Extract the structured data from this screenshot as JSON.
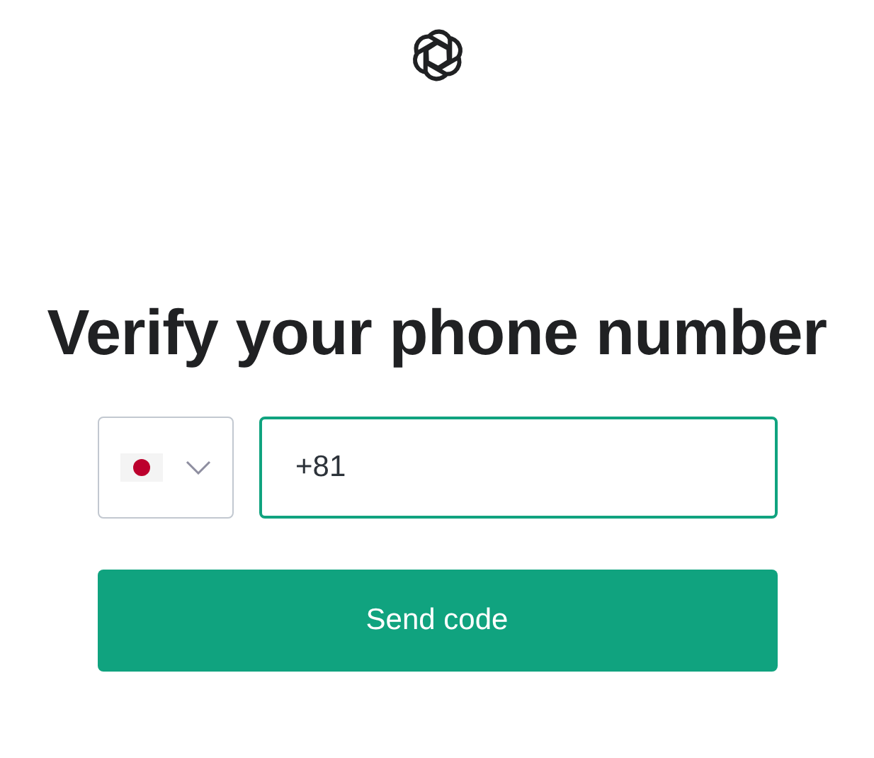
{
  "heading": "Verify your phone number",
  "phone": {
    "value": "+81",
    "focused": true
  },
  "buttons": [
    {
      "label": "Send code"
    }
  ]
}
